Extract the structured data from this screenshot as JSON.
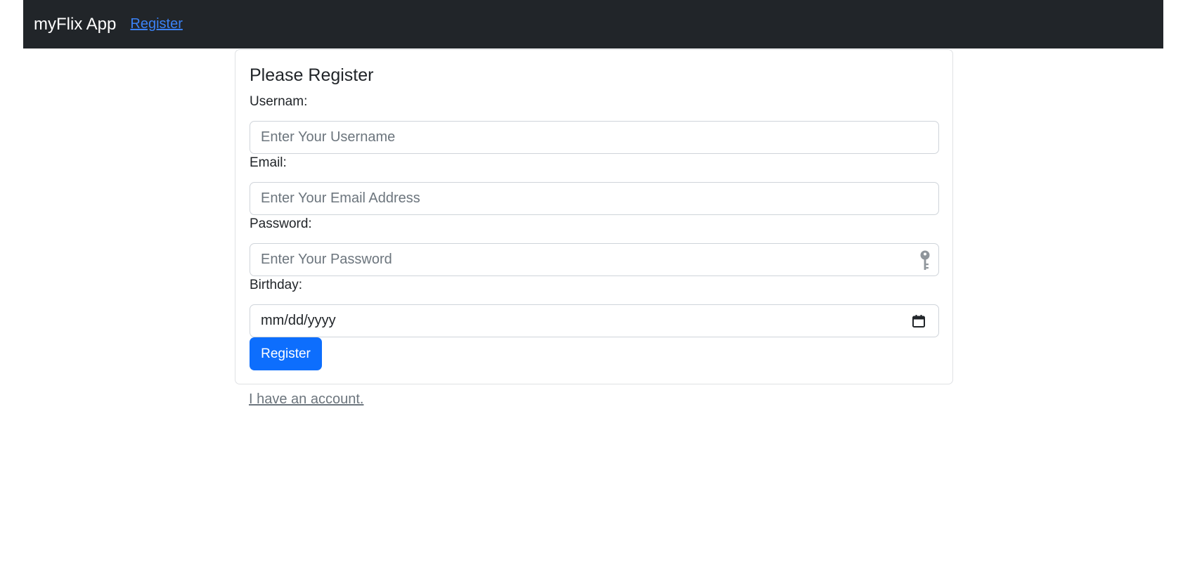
{
  "navbar": {
    "brand": "myFlix App",
    "links": [
      {
        "label": "Register"
      }
    ]
  },
  "form": {
    "title": "Please Register",
    "fields": {
      "username": {
        "label": "Usernam:",
        "placeholder": "Enter Your Username",
        "value": ""
      },
      "email": {
        "label": "Email:",
        "placeholder": "Enter Your Email Address",
        "value": ""
      },
      "password": {
        "label": "Password:",
        "placeholder": "Enter Your Password",
        "value": "",
        "icon": "key-icon"
      },
      "birthday": {
        "label": "Birthday:",
        "display": "mm/dd/yyyy",
        "icon": "calendar-icon"
      }
    },
    "submit_label": "Register"
  },
  "footer_link": "I have an account.",
  "colors": {
    "navbar_bg": "#212529",
    "primary": "#0d6efd",
    "nav_link": "#3b82f6",
    "muted": "#6c757d"
  }
}
